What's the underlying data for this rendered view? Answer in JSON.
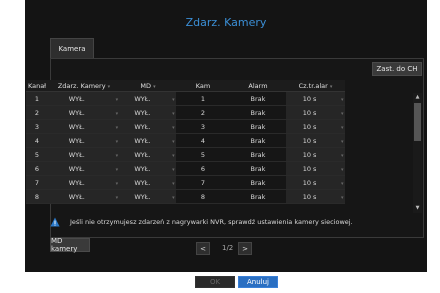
{
  "dialog_title": "Zdarz. Kamery",
  "tab_label": "Kamera",
  "copy_button": "Zast. do CH",
  "columns": [
    "Kanał",
    "Zdarz. Kamery",
    "MD",
    "Kam",
    "Alarm",
    "Cz.tr.alar"
  ],
  "rows": [
    {
      "ch": "1",
      "event": "WYŁ.",
      "md": "WYŁ.",
      "cam": "1",
      "alarm": "Brak",
      "time": "10 s"
    },
    {
      "ch": "2",
      "event": "WYŁ.",
      "md": "WYŁ.",
      "cam": "2",
      "alarm": "Brak",
      "time": "10 s"
    },
    {
      "ch": "3",
      "event": "WYŁ.",
      "md": "WYŁ.",
      "cam": "3",
      "alarm": "Brak",
      "time": "10 s"
    },
    {
      "ch": "4",
      "event": "WYŁ.",
      "md": "WYŁ.",
      "cam": "4",
      "alarm": "Brak",
      "time": "10 s"
    },
    {
      "ch": "5",
      "event": "WYŁ.",
      "md": "WYŁ.",
      "cam": "5",
      "alarm": "Brak",
      "time": "10 s"
    },
    {
      "ch": "6",
      "event": "WYŁ.",
      "md": "WYŁ.",
      "cam": "6",
      "alarm": "Brak",
      "time": "10 s"
    },
    {
      "ch": "7",
      "event": "WYŁ.",
      "md": "WYŁ.",
      "cam": "7",
      "alarm": "Brak",
      "time": "10 s"
    },
    {
      "ch": "8",
      "event": "WYŁ.",
      "md": "WYŁ.",
      "cam": "8",
      "alarm": "Brak",
      "time": "10 s"
    }
  ],
  "notice": "Jeśli nie otrzymujesz zdarzeń z nagrywarki NVR, sprawdź ustawienia kamery sieciowej.",
  "md_button": "MD kamery",
  "pager": {
    "prev": "<",
    "page": "1/2",
    "next": ">"
  },
  "footer": {
    "ok": "OK",
    "cancel": "Anuluj"
  },
  "colors": {
    "accent": "#3b8fd6",
    "cancel_bg": "#2a6fc2",
    "background": "#141414"
  }
}
